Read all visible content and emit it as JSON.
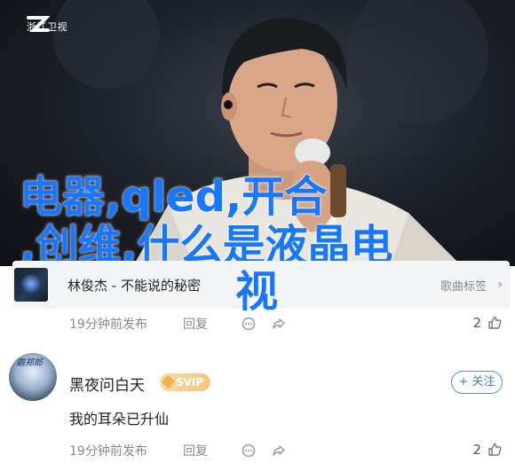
{
  "hero": {
    "channel_logo_text": "浙江卫视",
    "overlay_title_line1": "电器,qled,开合",
    "overlay_title_line2": ",创维,什么是液晶电",
    "overlay_title_line3": "视"
  },
  "music_card": {
    "title": "林俊杰 - 不能说的秘密",
    "label": "歌曲标签",
    "arrow": "›"
  },
  "post_meta": {
    "time": "19分钟前发布",
    "reply": "回复",
    "likes": "2"
  },
  "comment": {
    "avatar_text": "霸郑郎",
    "username": "黑夜问白天",
    "badge": "SVIP",
    "follow_label": "+ 关注",
    "content": "我的耳朵已升仙",
    "time": "19分钟前发布",
    "reply": "回复",
    "likes": "2"
  },
  "colors": {
    "overlay_title": "#1877ff",
    "follow": "#3f7fd5",
    "badge": "#f2c77f"
  }
}
